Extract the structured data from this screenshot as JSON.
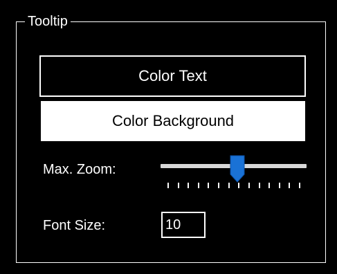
{
  "window": {
    "background": "#000000"
  },
  "tooltip_group": {
    "title": "Tooltip",
    "color_text_button": {
      "label": "Color Text",
      "text_color": "#ffffff",
      "background": "#000000"
    },
    "color_background_button": {
      "label": "Color Background",
      "text_color": "#000000",
      "background": "#ffffff"
    },
    "max_zoom": {
      "label": "Max. Zoom:",
      "slider_position_fraction": 0.53,
      "tick_count": 14,
      "thumb_color": "#1a72d6"
    },
    "font_size": {
      "label": "Font Size:",
      "value": "10"
    }
  }
}
